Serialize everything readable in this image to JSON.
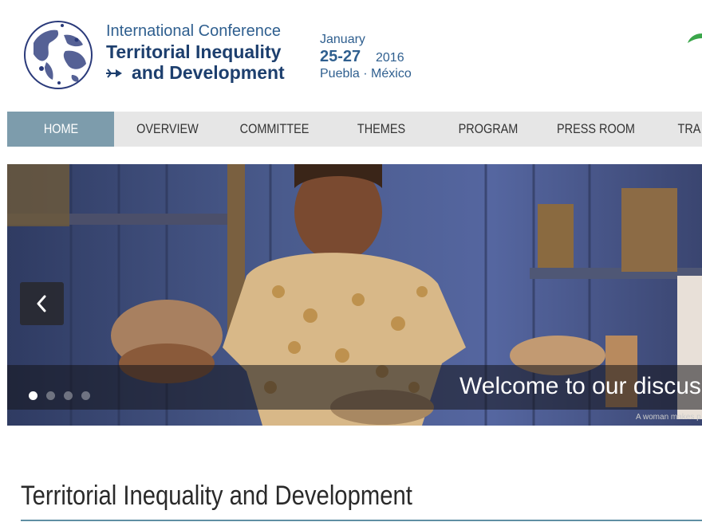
{
  "header": {
    "conference_line1": "International Conference",
    "conference_line2": "Territorial Inequality",
    "conference_line3": "and Development",
    "date_month": "January",
    "date_days": "25-27",
    "date_year": "2016",
    "date_place": "Puebla · México",
    "logo_icon": "globe-logo-icon",
    "colors": {
      "primary": "#1d3f6e",
      "secondary": "#2f5f8f"
    }
  },
  "nav": {
    "items": [
      {
        "label": "HOME",
        "active": true
      },
      {
        "label": "OVERVIEW"
      },
      {
        "label": "COMMITTEE"
      },
      {
        "label": "THEMES"
      },
      {
        "label": "PROGRAM"
      },
      {
        "label": "PRESS ROOM"
      },
      {
        "label": "TRA"
      }
    ],
    "colors": {
      "bar": "#e6e6e6",
      "active": "#7d9cac"
    }
  },
  "slider": {
    "caption": "Welcome to our discus",
    "credit": "A woman makes p",
    "prev_icon": "chevron-left-icon",
    "slide_count": 4,
    "active_slide": 1
  },
  "main": {
    "title": "Territorial Inequality and Development",
    "rule_color": "#5f8fa3"
  }
}
